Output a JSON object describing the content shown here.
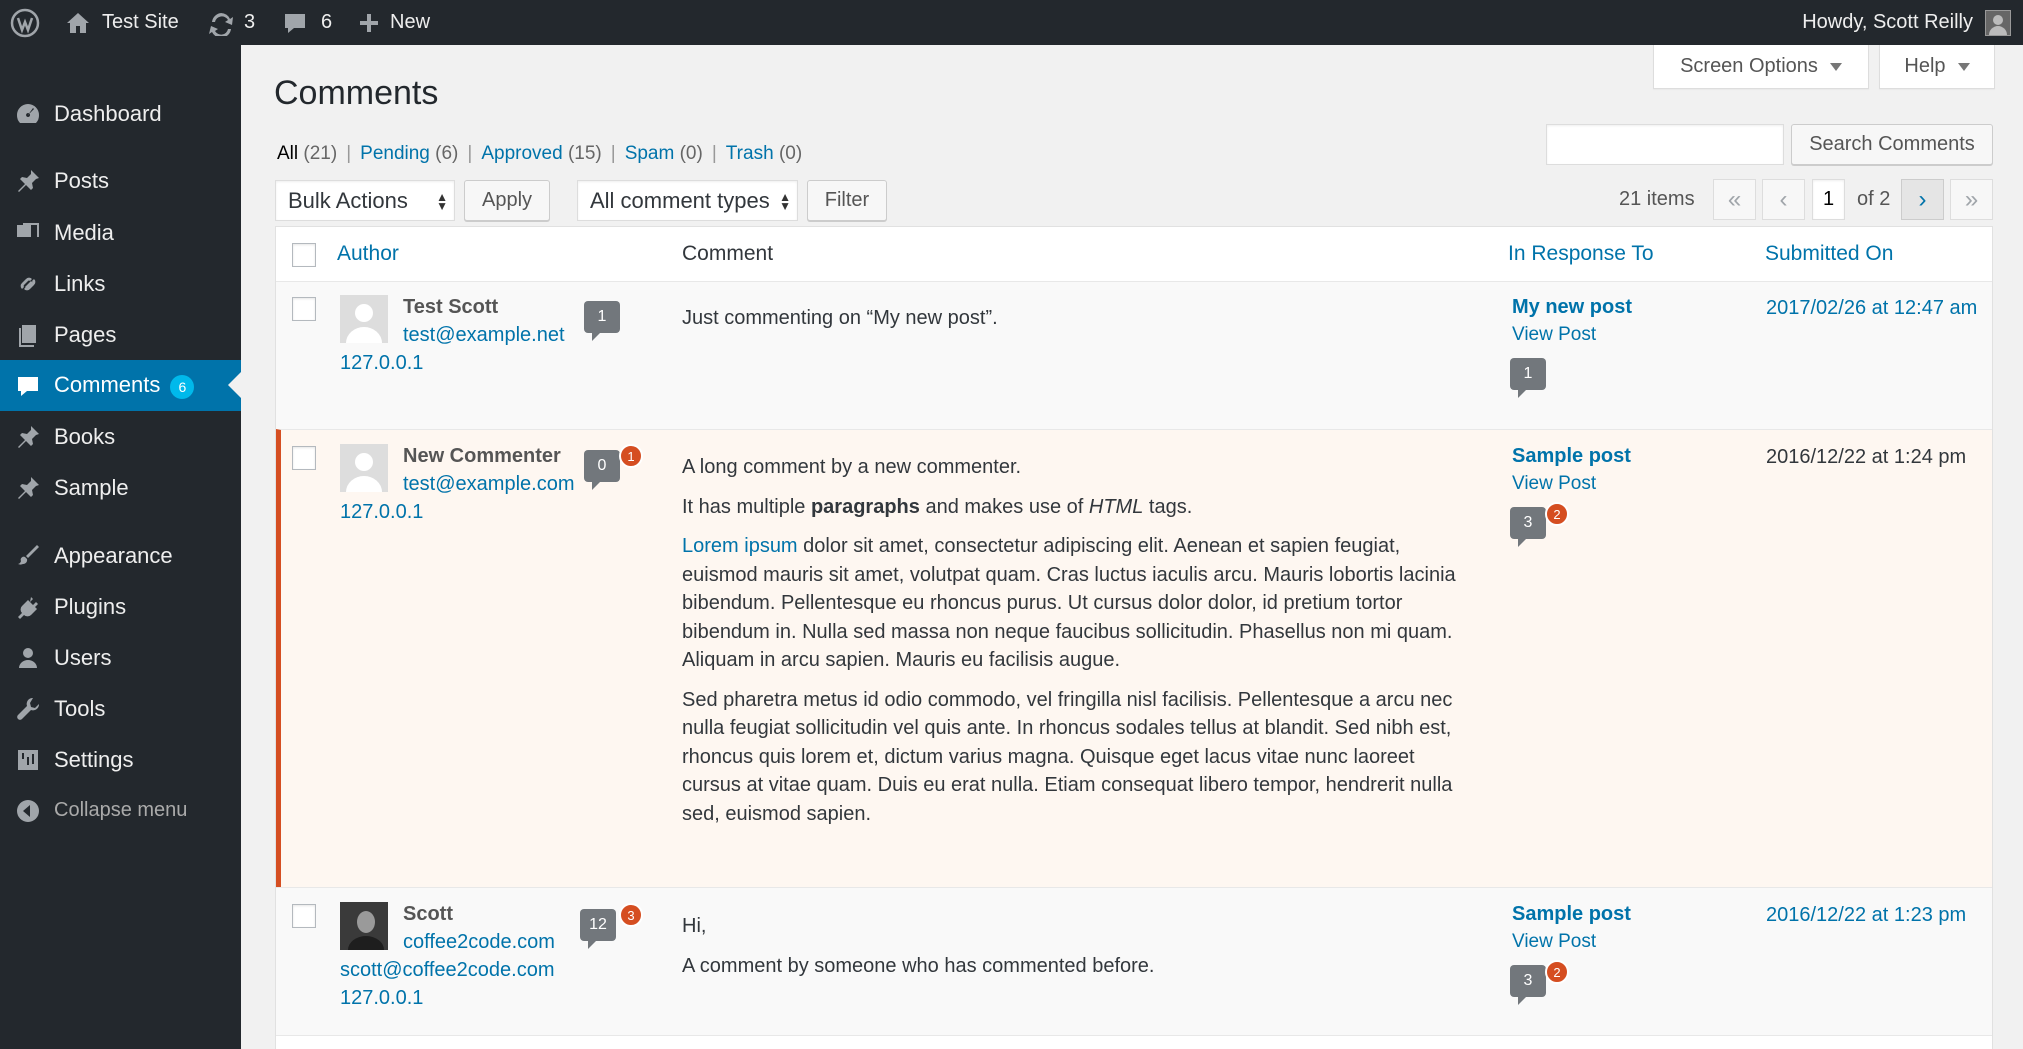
{
  "adminbar": {
    "site_name": "Test Site",
    "updates_count": "3",
    "comments_count": "6",
    "new_label": "New",
    "greeting": "Howdy, Scott Reilly"
  },
  "sidebar": {
    "items": [
      {
        "label": "Dashboard",
        "icon": "dashboard-icon"
      },
      {
        "label": "Posts",
        "icon": "pin-icon"
      },
      {
        "label": "Media",
        "icon": "media-icon"
      },
      {
        "label": "Links",
        "icon": "link-icon"
      },
      {
        "label": "Pages",
        "icon": "page-icon"
      },
      {
        "label": "Comments",
        "icon": "comment-icon",
        "count": "6"
      },
      {
        "label": "Books",
        "icon": "pin-icon"
      },
      {
        "label": "Sample",
        "icon": "pin-icon"
      },
      {
        "label": "Appearance",
        "icon": "brush-icon"
      },
      {
        "label": "Plugins",
        "icon": "plug-icon"
      },
      {
        "label": "Users",
        "icon": "user-icon"
      },
      {
        "label": "Tools",
        "icon": "wrench-icon"
      },
      {
        "label": "Settings",
        "icon": "settings-icon"
      },
      {
        "label": "Collapse menu",
        "icon": "collapse-icon"
      }
    ]
  },
  "screen_options_label": "Screen Options",
  "help_label": "Help",
  "page_title": "Comments",
  "filters": [
    {
      "label": "All",
      "count": "(21)"
    },
    {
      "label": "Pending",
      "count": "(6)"
    },
    {
      "label": "Approved",
      "count": "(15)"
    },
    {
      "label": "Spam",
      "count": "(0)"
    },
    {
      "label": "Trash",
      "count": "(0)"
    }
  ],
  "search": {
    "value": "",
    "button_label": "Search Comments"
  },
  "bulk_actions": {
    "selected": "Bulk Actions",
    "apply_label": "Apply"
  },
  "comment_type": {
    "selected": "All comment types",
    "filter_label": "Filter"
  },
  "pagination": {
    "items": "21 items",
    "first": "«",
    "prev": "‹",
    "current_page": "1",
    "of_total": "of 2",
    "next": "›",
    "last": "»"
  },
  "columns": {
    "author": "Author",
    "comment": "Comment",
    "response": "In Response To",
    "submitted": "Submitted On"
  },
  "comments": [
    {
      "author": "Test Scott",
      "email": "test@example.net",
      "ip": "127.0.0.1",
      "approved_count": "1",
      "paragraphs": [
        "Just commenting on “My new post”."
      ],
      "post_title": "My new post",
      "view_post": "View Post",
      "post_approved": "1",
      "date": "2017/02/26 at 12:47 am"
    },
    {
      "author": "New Commenter",
      "email": "test@example.com",
      "ip": "127.0.0.1",
      "approved_count": "0",
      "pending_count": "1",
      "p1": "A long comment by a new commenter.",
      "p2_a": "It has multiple ",
      "p2_b": "paragraphs",
      "p2_c": " and makes use of ",
      "p2_d": "HTML",
      "p2_e": " tags.",
      "p3_link": "Lorem ipsum",
      "p3_rest": " dolor sit amet, consectetur adipiscing elit. Aenean et sapien feugiat, euismod mauris sit amet, volutpat quam. Cras luctus iaculis arcu. Mauris lobortis lacinia bibendum. Pellentesque eu rhoncus purus. Ut cursus dolor dolor, id pretium tortor bibendum in. Nulla sed massa non neque faucibus sollicitudin. Phasellus non mi quam. Aliquam in arcu sapien. Mauris eu facilisis augue.",
      "p4": "Sed pharetra metus id odio commodo, vel fringilla nisl facilisis. Pellentesque a arcu nec nulla feugiat sollicitudin vel quis ante. In rhoncus sodales tellus at blandit. Sed nibh est, rhoncus quis lorem et, dictum varius magna. Quisque eget lacus vitae nunc laoreet cursus at vitae quam. Duis eu erat nulla. Etiam consequat libero tempor, hendrerit nulla sed, euismod sapien.",
      "post_title": "Sample post",
      "view_post": "View Post",
      "post_approved": "3",
      "post_pending": "2",
      "date": "2016/12/22 at 1:24 pm"
    },
    {
      "author": "Scott",
      "url": "coffee2code.com",
      "email": "scott@coffee2code.com",
      "ip": "127.0.0.1",
      "approved_count": "12",
      "pending_count": "3",
      "p1": "Hi,",
      "p2": "A comment by someone who has commented before.",
      "post_title": "Sample post",
      "view_post": "View Post",
      "post_approved": "3",
      "post_pending": "2",
      "date": "2016/12/22 at 1:23 pm"
    }
  ]
}
